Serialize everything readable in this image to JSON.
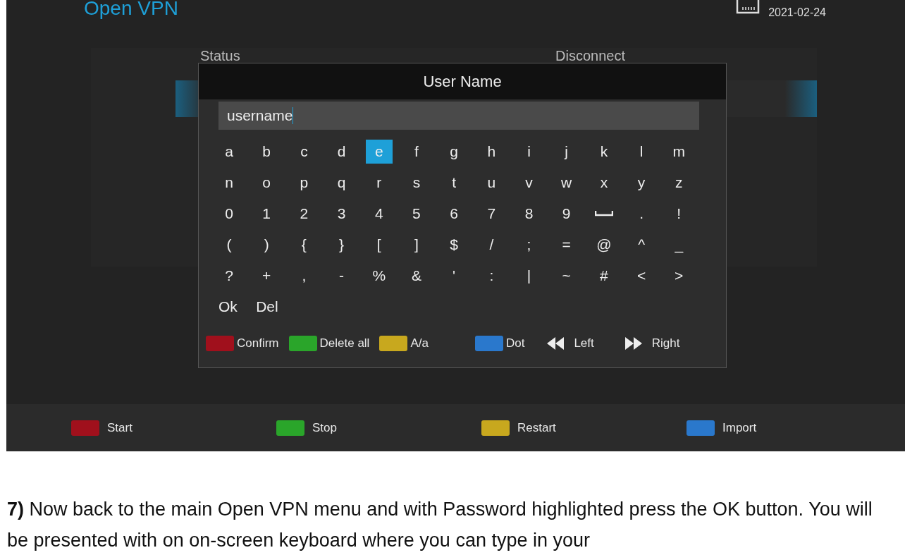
{
  "screen": {
    "title": "Open VPN",
    "date": "2021-02-24",
    "menu_labels": [
      "Status",
      "Disconnect"
    ],
    "dialog": {
      "title": "User Name",
      "value": "username",
      "keys": [
        [
          {
            "kind": "char",
            "label": "a",
            "selected": false
          },
          {
            "kind": "char",
            "label": "b",
            "selected": false
          },
          {
            "kind": "char",
            "label": "c",
            "selected": false
          },
          {
            "kind": "char",
            "label": "d",
            "selected": false
          },
          {
            "kind": "char",
            "label": "e",
            "selected": true
          },
          {
            "kind": "char",
            "label": "f",
            "selected": false
          },
          {
            "kind": "char",
            "label": "g",
            "selected": false
          },
          {
            "kind": "char",
            "label": "h",
            "selected": false
          },
          {
            "kind": "char",
            "label": "i",
            "selected": false
          },
          {
            "kind": "char",
            "label": "j",
            "selected": false
          },
          {
            "kind": "char",
            "label": "k",
            "selected": false
          },
          {
            "kind": "char",
            "label": "l",
            "selected": false
          },
          {
            "kind": "char",
            "label": "m",
            "selected": false
          }
        ],
        [
          {
            "kind": "char",
            "label": "n",
            "selected": false
          },
          {
            "kind": "char",
            "label": "o",
            "selected": false
          },
          {
            "kind": "char",
            "label": "p",
            "selected": false
          },
          {
            "kind": "char",
            "label": "q",
            "selected": false
          },
          {
            "kind": "char",
            "label": "r",
            "selected": false
          },
          {
            "kind": "char",
            "label": "s",
            "selected": false
          },
          {
            "kind": "char",
            "label": "t",
            "selected": false
          },
          {
            "kind": "char",
            "label": "u",
            "selected": false
          },
          {
            "kind": "char",
            "label": "v",
            "selected": false
          },
          {
            "kind": "char",
            "label": "w",
            "selected": false
          },
          {
            "kind": "char",
            "label": "x",
            "selected": false
          },
          {
            "kind": "char",
            "label": "y",
            "selected": false
          },
          {
            "kind": "char",
            "label": "z",
            "selected": false
          }
        ],
        [
          {
            "kind": "char",
            "label": "0",
            "selected": false
          },
          {
            "kind": "char",
            "label": "1",
            "selected": false
          },
          {
            "kind": "char",
            "label": "2",
            "selected": false
          },
          {
            "kind": "char",
            "label": "3",
            "selected": false
          },
          {
            "kind": "char",
            "label": "4",
            "selected": false
          },
          {
            "kind": "char",
            "label": "5",
            "selected": false
          },
          {
            "kind": "char",
            "label": "6",
            "selected": false
          },
          {
            "kind": "char",
            "label": "7",
            "selected": false
          },
          {
            "kind": "char",
            "label": "8",
            "selected": false
          },
          {
            "kind": "char",
            "label": "9",
            "selected": false
          },
          {
            "kind": "space",
            "selected": false
          },
          {
            "kind": "char",
            "label": ".",
            "selected": false
          },
          {
            "kind": "char",
            "label": "!",
            "selected": false
          }
        ],
        [
          {
            "kind": "char",
            "label": "(",
            "selected": false
          },
          {
            "kind": "char",
            "label": ")",
            "selected": false
          },
          {
            "kind": "char",
            "label": "{",
            "selected": false
          },
          {
            "kind": "char",
            "label": "}",
            "selected": false
          },
          {
            "kind": "char",
            "label": "[",
            "selected": false
          },
          {
            "kind": "char",
            "label": "]",
            "selected": false
          },
          {
            "kind": "char",
            "label": "$",
            "selected": false
          },
          {
            "kind": "char",
            "label": "/",
            "selected": false
          },
          {
            "kind": "char",
            "label": ";",
            "selected": false
          },
          {
            "kind": "char",
            "label": "=",
            "selected": false
          },
          {
            "kind": "char",
            "label": "@",
            "selected": false
          },
          {
            "kind": "char",
            "label": "^",
            "selected": false
          },
          {
            "kind": "char",
            "label": "_",
            "selected": false
          }
        ],
        [
          {
            "kind": "char",
            "label": "?",
            "selected": false
          },
          {
            "kind": "char",
            "label": "+",
            "selected": false
          },
          {
            "kind": "char",
            "label": ",",
            "selected": false
          },
          {
            "kind": "char",
            "label": "-",
            "selected": false
          },
          {
            "kind": "char",
            "label": "%",
            "selected": false
          },
          {
            "kind": "char",
            "label": "&",
            "selected": false
          },
          {
            "kind": "char",
            "label": "'",
            "selected": false
          },
          {
            "kind": "char",
            "label": ":",
            "selected": false
          },
          {
            "kind": "char",
            "label": "|",
            "selected": false
          },
          {
            "kind": "char",
            "label": "~",
            "selected": false
          },
          {
            "kind": "char",
            "label": "#",
            "selected": false
          },
          {
            "kind": "char",
            "label": "<",
            "selected": false
          },
          {
            "kind": "char",
            "label": ">",
            "selected": false
          }
        ],
        [
          {
            "kind": "word",
            "label": "Ok",
            "selected": false
          },
          {
            "kind": "word",
            "label": "Del",
            "selected": false
          }
        ]
      ],
      "hints": [
        {
          "kind": "color",
          "color": "#a0101c",
          "label": "Confirm"
        },
        {
          "kind": "color",
          "color": "#2aa52a",
          "label": "Delete all"
        },
        {
          "kind": "color",
          "color": "#c8a81e",
          "label": "A/a"
        },
        {
          "kind": "color",
          "color": "#2a78cc",
          "label": "Dot"
        },
        {
          "kind": "rewind",
          "label": "Left"
        },
        {
          "kind": "forward",
          "label": "Right"
        }
      ]
    },
    "footer": [
      {
        "color": "#a0101c",
        "label": "Start"
      },
      {
        "color": "#2aa52a",
        "label": "Stop"
      },
      {
        "color": "#c8a81e",
        "label": "Restart"
      },
      {
        "color": "#2a78cc",
        "label": "Import"
      }
    ]
  },
  "article": {
    "text": "**7)** Now back to the main Open VPN menu and with Password highlighted press the OK button. You will be presented with on on-screen keyboard where you can type in your"
  }
}
